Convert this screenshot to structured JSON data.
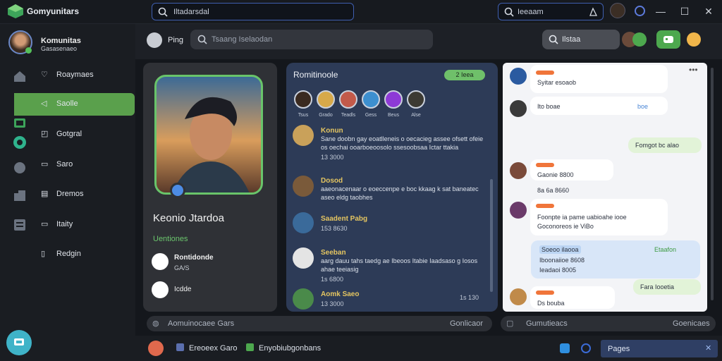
{
  "app": {
    "title": "Gomyunitars"
  },
  "top": {
    "search_value": "Iltadarsdal",
    "search2_value": "Ieeaam"
  },
  "profile": {
    "name": "Komunitas",
    "sub": "Gasasenaeo"
  },
  "nav": [
    {
      "label": "Roaymaes",
      "icon": "heart-icon"
    },
    {
      "label": "Saolle",
      "icon": "share-icon",
      "active": true
    },
    {
      "label": "Gotgral",
      "icon": "bell-icon"
    },
    {
      "label": "Saro",
      "icon": "folder-icon"
    },
    {
      "label": "Dremos",
      "icon": "grid-icon"
    },
    {
      "label": "Itaity",
      "icon": "folder-icon"
    },
    {
      "label": "Redgin",
      "icon": "file-icon"
    }
  ],
  "subbar": {
    "ping_label": "Ping",
    "search_placeholder": "Tsaang Iselaodan",
    "right_search": "Ilstaa"
  },
  "profile_card": {
    "name": "Keonio Jtardoa",
    "section": "Uentiones",
    "f1_name": "Rontidonde",
    "f1_sub": "GA/S",
    "f2_name": "Icdde"
  },
  "community": {
    "title": "Romitinoole",
    "badge": "2 Ieea",
    "avatar_names": [
      "Tsus",
      "Grado",
      "Teadls",
      "Gess",
      "Beus",
      "Alse"
    ],
    "messages": [
      {
        "name": "Konun",
        "body": "Sane doobn gay eoatlleneis o oecacieg assee ofsett ofeie os oechai ooarboeoosolo ssesoobsaa Ictar ttakia",
        "time": "13 3000"
      },
      {
        "name": "Dosod",
        "body": "aaeonacenaar o eoeccenpe e boc kkaag k sat baneatec aseo eldg taobhes",
        "time": ""
      },
      {
        "name": "Saadent Pabg",
        "body": "",
        "time": "153 8630"
      },
      {
        "name": "Seeban",
        "body": "aarg dauu tahs taedg ae Ibeoos Itabie Iaadsaso g Iosos ahae teeiasig",
        "time": "1s 6800"
      },
      {
        "name": "Aomk",
        "body": "Saeo",
        "time": "13 3000",
        "right": "1s 130"
      }
    ]
  },
  "chat": {
    "messages": [
      {
        "side": "left",
        "text": "Syitar esoaob"
      },
      {
        "side": "left",
        "text": "Ito boae",
        "meta": "boe"
      },
      {
        "side": "right",
        "text": "Fomgot bc alao"
      },
      {
        "side": "left",
        "text": "Gaonie 8800"
      },
      {
        "side": "left",
        "text": "8a 6a 8660"
      },
      {
        "side": "left",
        "text": "Foonpte ia pame uabioahe iooe Goconoreos ie ViBo"
      },
      {
        "side": "right",
        "text": "Soeoo ilaooa",
        "sub": "Iboonaiioe 8608",
        "sub2": "Ieadaoi 8005",
        "meta": "Etaafon"
      },
      {
        "side": "right",
        "text": "Fara Iooetia"
      },
      {
        "side": "left",
        "text": "Ds bouba"
      }
    ]
  },
  "bottom_inputs": {
    "left": "Aomuinocaee Gars",
    "left_right": "Gonlicaor",
    "right": "Gumutieacs",
    "right_right": "Goenicaes"
  },
  "status": {
    "item1": "Ereoeex Garo",
    "item2": "Enyobiubgonbans",
    "pages": "Pages"
  }
}
